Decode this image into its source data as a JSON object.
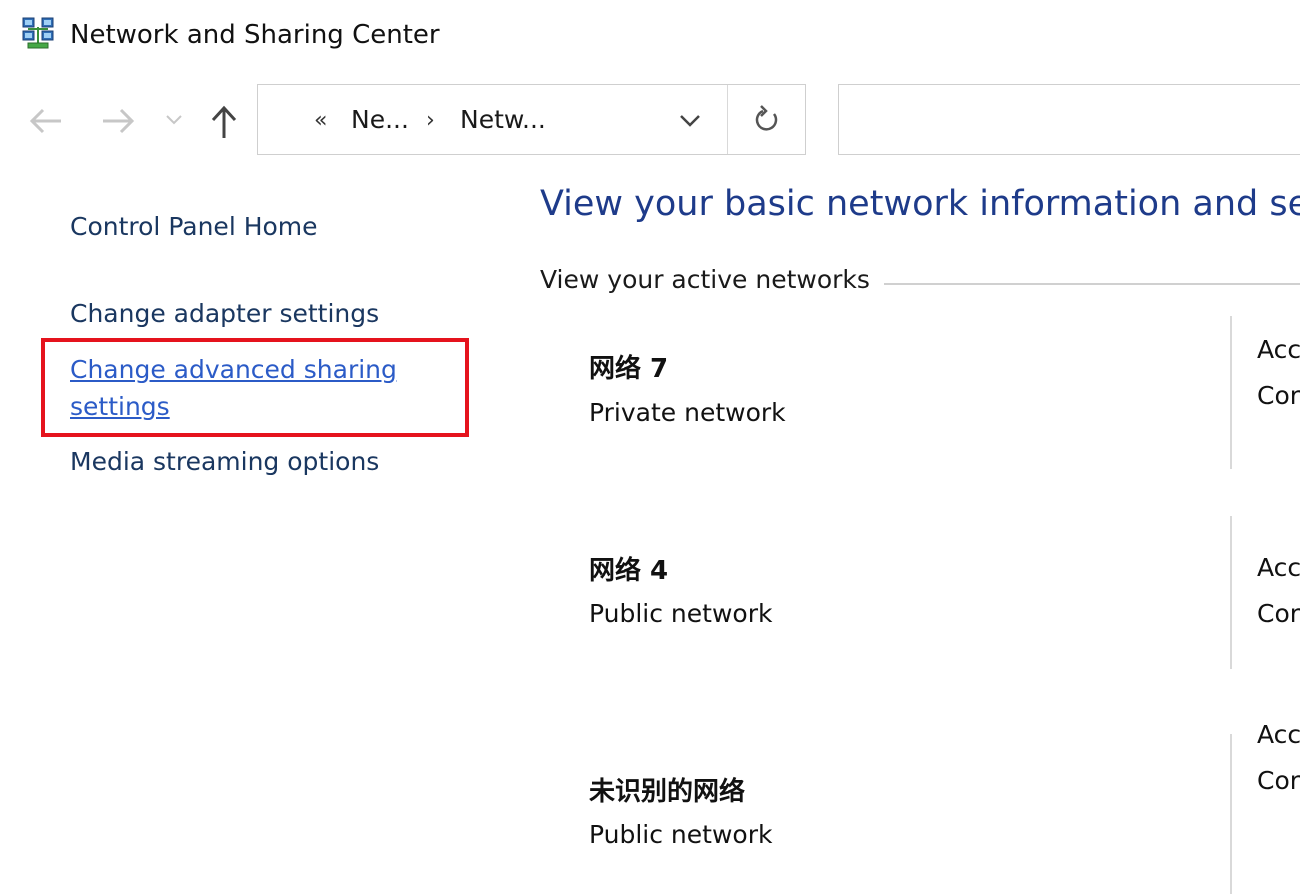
{
  "window": {
    "title": "Network and Sharing Center",
    "icon": "network-center-icon"
  },
  "nav": {
    "back_icon": "back-arrow-icon",
    "forward_icon": "forward-arrow-icon",
    "recent_icon": "chevron-down-icon",
    "up_icon": "up-arrow-icon",
    "overflow_marker": "«",
    "breadcrumbs": [
      "Ne...",
      "Netw..."
    ],
    "crumb_separator": "›",
    "refresh_icon": "refresh-icon",
    "search_placeholder": ""
  },
  "left_pane": {
    "home_link": "Control Panel Home",
    "links": [
      {
        "label": "Change adapter settings"
      },
      {
        "label": "Change advanced sharing settings",
        "highlighted": true
      },
      {
        "label": "Media streaming options"
      }
    ],
    "highlight_color": "#e5131d"
  },
  "main": {
    "heading": "View your basic network information and set",
    "active_section_label": "View your active networks",
    "networks": [
      {
        "name": "网络 7",
        "type": "Private network",
        "access_label": "Acc",
        "connections_label": "Cor"
      },
      {
        "name": "网络 4",
        "type": "Public network",
        "access_label": "Acc",
        "connections_label": "Cor"
      },
      {
        "name": "未识别的网络",
        "type": "Public network",
        "access_label": "Acc",
        "connections_label": "Cor"
      }
    ]
  },
  "colors": {
    "heading": "#1e3b8a",
    "link": "#1a3760",
    "active_link": "#2b5bc7"
  }
}
